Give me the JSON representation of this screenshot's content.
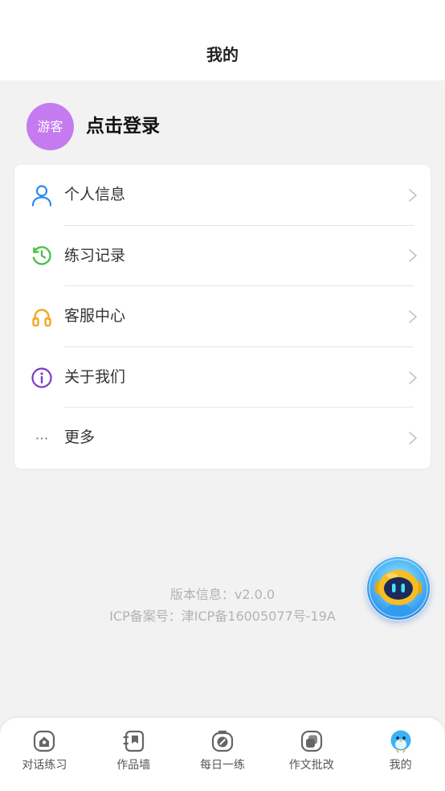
{
  "header": {
    "title": "我的"
  },
  "profile": {
    "avatar_text": "游客",
    "login_label": "点击登录"
  },
  "menu": {
    "items": [
      {
        "label": "个人信息",
        "icon": "person-icon"
      },
      {
        "label": "练习记录",
        "icon": "history-clock-icon"
      },
      {
        "label": "客服中心",
        "icon": "headphones-icon"
      },
      {
        "label": "关于我们",
        "icon": "info-icon"
      },
      {
        "label": "更多",
        "icon": "more-dots-icon"
      }
    ]
  },
  "about": {
    "version": "版本信息：v2.0.0",
    "icp": "ICP备案号：津ICP备16005077号-19A"
  },
  "floating_assistant": {
    "icon": "robot-assistant-icon"
  },
  "tabbar": {
    "active_index": 4,
    "tabs": [
      {
        "label": "对话练习",
        "icon": "chat-practice-icon"
      },
      {
        "label": "作品墙",
        "icon": "works-wall-icon"
      },
      {
        "label": "每日一练",
        "icon": "daily-practice-icon"
      },
      {
        "label": "作文批改",
        "icon": "essay-correction-icon"
      },
      {
        "label": "我的",
        "icon": "mascot-bird-icon"
      }
    ]
  },
  "colors": {
    "page_background": "#f2f2f2",
    "avatar": "#c57bef",
    "person_icon": "#2a8cf0",
    "clock_icon": "#4cc24a",
    "headphones_icon": "#f5a623",
    "info_icon": "#7a3cc8",
    "muted_text": "#b3b3b3"
  }
}
